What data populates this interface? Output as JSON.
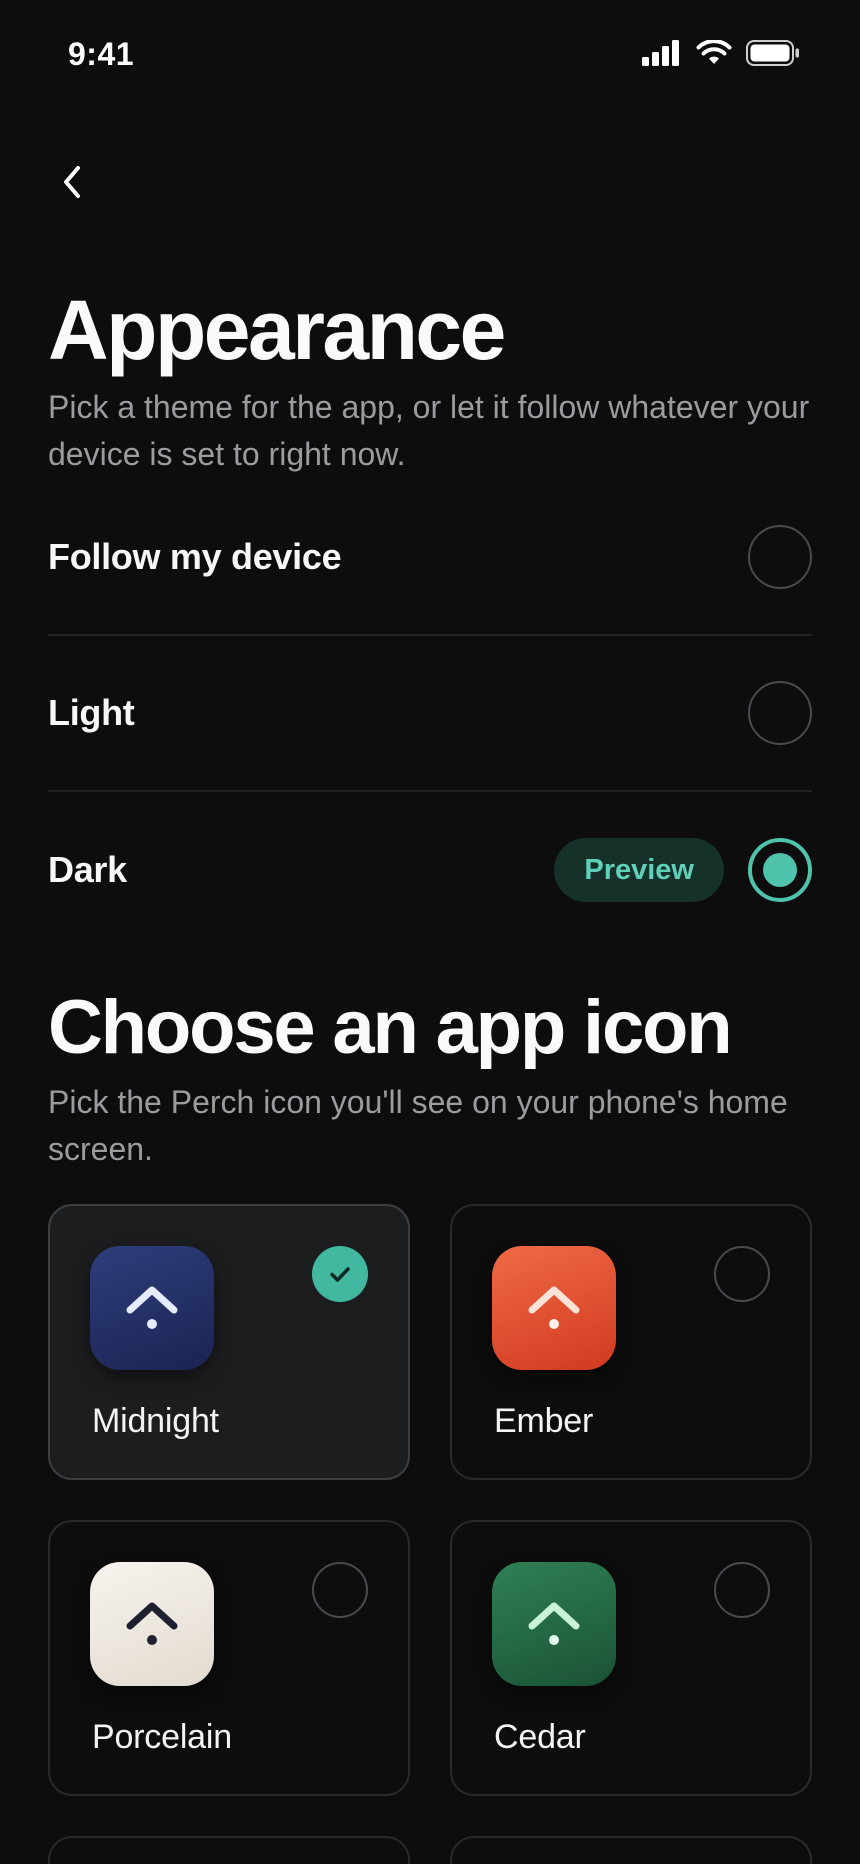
{
  "status_bar": {
    "time": "9:41",
    "icons": [
      "cellular-signal-icon",
      "wifi-icon",
      "battery-icon"
    ]
  },
  "nav": {
    "back_icon": "chevron-left-icon"
  },
  "appearance": {
    "title": "Appearance",
    "description": "Pick a theme for the app, or let it follow whatever your device is set to right now.",
    "options": [
      {
        "label": "Follow my device",
        "selected": false
      },
      {
        "label": "Light",
        "selected": false
      },
      {
        "label": "Dark",
        "selected": true,
        "badge": "Preview"
      }
    ]
  },
  "app_icon": {
    "title": "Choose an app icon",
    "description": "Pick the Perch icon you'll see on your phone's home screen.",
    "icons": [
      {
        "label": "Midnight",
        "selected": true,
        "colors": [
          "#2b3a73",
          "#1c2553"
        ],
        "glyph": "#e6ecff"
      },
      {
        "label": "Ember",
        "selected": false,
        "colors": [
          "#ee6340",
          "#d23c22"
        ],
        "glyph": "#fff1ea"
      },
      {
        "label": "Porcelain",
        "selected": false,
        "colors": [
          "#f4efe9",
          "#e4ddd3"
        ],
        "glyph": "#1e2030"
      },
      {
        "label": "Cedar",
        "selected": false,
        "colors": [
          "#2c7a50",
          "#1c5a3a"
        ],
        "glyph": "#e8fbef"
      }
    ]
  },
  "colors": {
    "background": "#0d0d0e",
    "accent": "#4fc3ab",
    "accent_pill_bg": "#16302a"
  }
}
